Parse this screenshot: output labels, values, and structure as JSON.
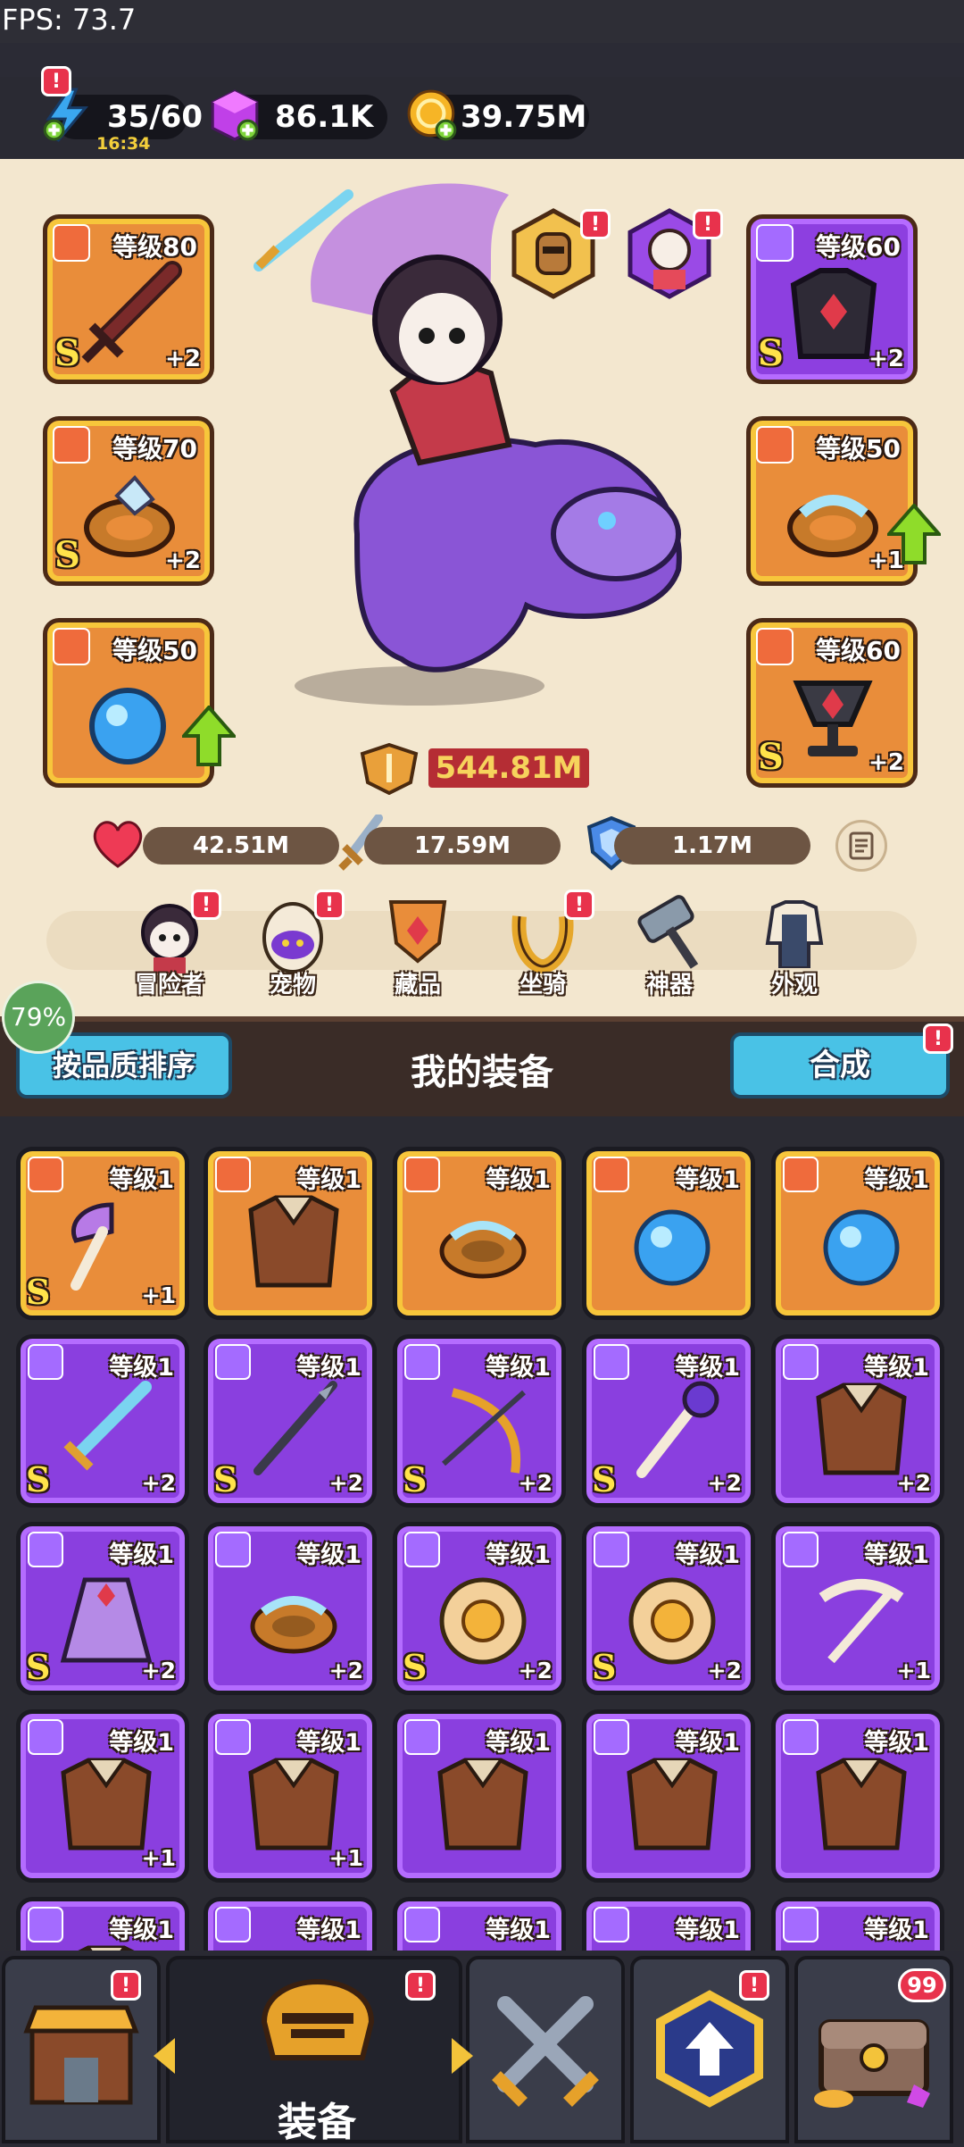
{
  "fps": "FPS: 73.7",
  "resources": {
    "energy": "35/60",
    "energy_timer": "16:34",
    "gems": "86.1K",
    "coins": "39.75M"
  },
  "hero": {
    "left_slots": [
      {
        "level": "等级80",
        "grade": "S",
        "plus": "+2",
        "tier": "gold",
        "icon": "sword-icon"
      },
      {
        "level": "等级70",
        "grade": "S",
        "plus": "+2",
        "tier": "gold",
        "icon": "ring-icon"
      },
      {
        "level": "等级50",
        "grade": "",
        "plus": "",
        "tier": "gold",
        "icon": "necklace-icon"
      }
    ],
    "right_slots": [
      {
        "level": "等级60",
        "grade": "S",
        "plus": "+2",
        "tier": "purple",
        "icon": "armor-icon"
      },
      {
        "level": "等级50",
        "grade": "",
        "plus": "+1",
        "tier": "gold",
        "icon": "ring-icon"
      },
      {
        "level": "等级60",
        "grade": "S",
        "plus": "+2",
        "tier": "gold",
        "icon": "chalice-icon"
      }
    ],
    "power": "544.81M",
    "hp": "42.51M",
    "attack": "17.59M",
    "defense": "1.17M"
  },
  "tabs": [
    {
      "label": "冒险者",
      "badge": true,
      "icon": "adventurer-icon"
    },
    {
      "label": "宠物",
      "badge": true,
      "icon": "pet-egg-icon"
    },
    {
      "label": "藏品",
      "badge": false,
      "icon": "collection-icon"
    },
    {
      "label": "坐骑",
      "badge": true,
      "icon": "mount-icon"
    },
    {
      "label": "神器",
      "badge": false,
      "icon": "artifact-hammer-icon"
    },
    {
      "label": "外观",
      "badge": false,
      "icon": "outfit-icon"
    }
  ],
  "progress_percent": "79%",
  "equip_header": {
    "sort_label": "按品质排序",
    "title": "我的装备",
    "merge_label": "合成"
  },
  "inventory": [
    {
      "level": "等级1",
      "tier": "gold",
      "grade": "S",
      "plus": "+1",
      "icon": "axe-icon"
    },
    {
      "level": "等级1",
      "tier": "gold",
      "grade": "",
      "plus": "",
      "icon": "armor-icon"
    },
    {
      "level": "等级1",
      "tier": "gold",
      "grade": "",
      "plus": "",
      "icon": "ring-icon"
    },
    {
      "level": "等级1",
      "tier": "gold",
      "grade": "",
      "plus": "",
      "icon": "necklace-icon"
    },
    {
      "level": "等级1",
      "tier": "gold",
      "grade": "",
      "plus": "",
      "icon": "necklace-icon"
    },
    {
      "level": "等级1",
      "tier": "purple",
      "grade": "S",
      "plus": "+2",
      "icon": "sword-icon"
    },
    {
      "level": "等级1",
      "tier": "purple",
      "grade": "S",
      "plus": "+2",
      "icon": "spear-icon"
    },
    {
      "level": "等级1",
      "tier": "purple",
      "grade": "S",
      "plus": "+2",
      "icon": "bow-icon"
    },
    {
      "level": "等级1",
      "tier": "purple",
      "grade": "S",
      "plus": "+2",
      "icon": "staff-icon"
    },
    {
      "level": "等级1",
      "tier": "purple",
      "grade": "",
      "plus": "+2",
      "icon": "armor-icon"
    },
    {
      "level": "等级1",
      "tier": "purple",
      "grade": "S",
      "plus": "+2",
      "icon": "cloak-icon"
    },
    {
      "level": "等级1",
      "tier": "purple",
      "grade": "",
      "plus": "+2",
      "icon": "ring-icon"
    },
    {
      "level": "等级1",
      "tier": "purple",
      "grade": "S",
      "plus": "+2",
      "icon": "medal-icon"
    },
    {
      "level": "等级1",
      "tier": "purple",
      "grade": "S",
      "plus": "+2",
      "icon": "medal-icon"
    },
    {
      "level": "等级1",
      "tier": "purple",
      "grade": "",
      "plus": "+1",
      "icon": "crossbow-icon"
    },
    {
      "level": "等级1",
      "tier": "purple",
      "grade": "",
      "plus": "+1",
      "icon": "armor-icon"
    },
    {
      "level": "等级1",
      "tier": "purple",
      "grade": "",
      "plus": "+1",
      "icon": "armor-icon"
    },
    {
      "level": "等级1",
      "tier": "purple",
      "grade": "",
      "plus": "",
      "icon": "armor-icon"
    },
    {
      "level": "等级1",
      "tier": "purple",
      "grade": "",
      "plus": "",
      "icon": "armor-icon"
    },
    {
      "level": "等级1",
      "tier": "purple",
      "grade": "",
      "plus": "",
      "icon": "armor-icon"
    },
    {
      "level": "等级1",
      "tier": "purple",
      "grade": "",
      "plus": "",
      "icon": "armor-icon"
    },
    {
      "level": "等级1",
      "tier": "purple",
      "grade": "",
      "plus": "",
      "icon": "ring-icon"
    },
    {
      "level": "等级1",
      "tier": "purple",
      "grade": "",
      "plus": "",
      "icon": "ring-icon"
    },
    {
      "level": "等级1",
      "tier": "purple",
      "grade": "",
      "plus": "",
      "icon": "ring-icon"
    },
    {
      "level": "等级1",
      "tier": "purple",
      "grade": "",
      "plus": "",
      "icon": "ring-icon"
    }
  ],
  "bottom_nav": {
    "active_label": "装备",
    "chest_count": "99",
    "items": [
      "shop-icon",
      "equipment-helmet-icon",
      "battle-swords-icon",
      "upgrade-icon",
      "treasure-chest-icon"
    ]
  },
  "colors": {
    "gold_tier": "#e98d3a",
    "purple_tier": "#8a3fdf",
    "button_blue": "#49c2e6",
    "badge_red": "#e8324c"
  }
}
